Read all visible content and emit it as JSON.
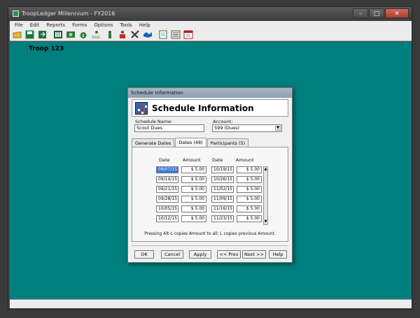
{
  "window": {
    "title": "TroopLedger Millennium - FY2016",
    "controls": [
      "–",
      "□",
      "✕"
    ]
  },
  "menu": [
    "File",
    "Edit",
    "Reports",
    "Forms",
    "Options",
    "Tools",
    "Help"
  ],
  "toolbar_icons": [
    "open-folder-icon",
    "save-icon",
    "export-icon",
    "people-icon",
    "money-icon",
    "ggg-icon",
    "scout-icon",
    "person-icon",
    "tools-icon",
    "handshake-icon",
    "notepad-icon",
    "list-icon",
    "calendar-icon"
  ],
  "troop_label": "Troop 123",
  "dialog": {
    "title": "Schedule Information",
    "header": "Schedule Information",
    "schedule_name_label": "Schedule Name:",
    "schedule_name_value": "Scout Dues",
    "account_label": "Account:",
    "account_value": "599 (Dues)",
    "tabs": [
      {
        "label": "Generate Dates",
        "active": false
      },
      {
        "label": "Dates (48)",
        "active": true
      },
      {
        "label": "Participants (5)",
        "active": false
      }
    ],
    "columns": [
      "Date",
      "Amount",
      "Date",
      "Amount"
    ],
    "rows": [
      {
        "date1": "09/07/15",
        "amt1": "$ 5.00",
        "date2": "10/19/15",
        "amt2": "$ 5.00"
      },
      {
        "date1": "09/14/15",
        "amt1": "$ 5.00",
        "date2": "10/26/15",
        "amt2": "$ 5.00"
      },
      {
        "date1": "09/21/15",
        "amt1": "$ 5.00",
        "date2": "11/02/15",
        "amt2": "$ 5.00"
      },
      {
        "date1": "09/28/15",
        "amt1": "$ 5.00",
        "date2": "11/09/15",
        "amt2": "$ 5.00"
      },
      {
        "date1": "10/05/15",
        "amt1": "$ 5.00",
        "date2": "11/16/15",
        "amt2": "$ 5.00"
      },
      {
        "date1": "10/12/15",
        "amt1": "$ 5.00",
        "date2": "11/23/15",
        "amt2": "$ 5.00"
      }
    ],
    "hint": "Pressing Alt-L copies Amount to all; L copies previous Amount.",
    "buttons": {
      "ok": "OK",
      "cancel": "Cancel",
      "apply": "Apply",
      "prev": "<< Prev",
      "next": "Next >>",
      "help": "Help"
    }
  },
  "colors": {
    "desktop_teal": "#007f7f",
    "selection": "#3875d7"
  }
}
